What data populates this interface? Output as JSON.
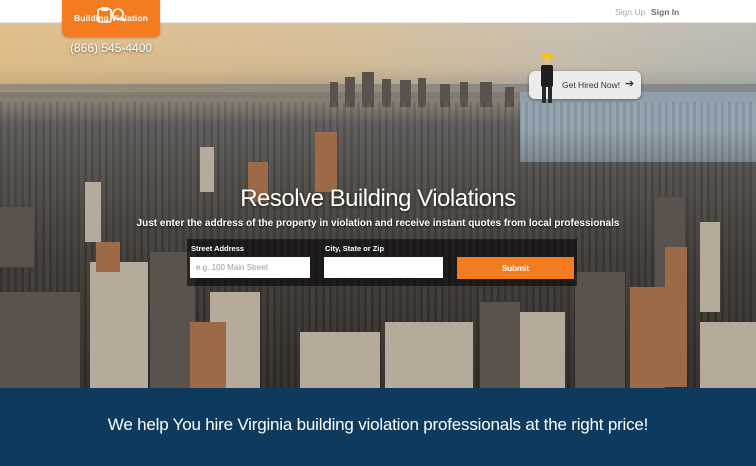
{
  "header": {
    "logo_text": "Building Violation",
    "phone": "(866) 545-4400",
    "nav": {
      "signup": "Sign Up",
      "signin": "Sign In"
    }
  },
  "hero": {
    "get_hired": "Get Hired Now!",
    "title": "Resolve Building Violations",
    "subtitle": "Just enter the address of the property in violation and receive instant quotes from local professionals",
    "form": {
      "street_label": "Street Address",
      "street_placeholder": "e.g. 100 Main Street",
      "city_label": "City, State or Zip",
      "city_placeholder": "",
      "submit": "Submit"
    }
  },
  "band": {
    "text": "We help You hire Virginia building violation professionals at the right price!"
  },
  "colors": {
    "accent": "#f47b20",
    "band": "#0e3a5e"
  }
}
